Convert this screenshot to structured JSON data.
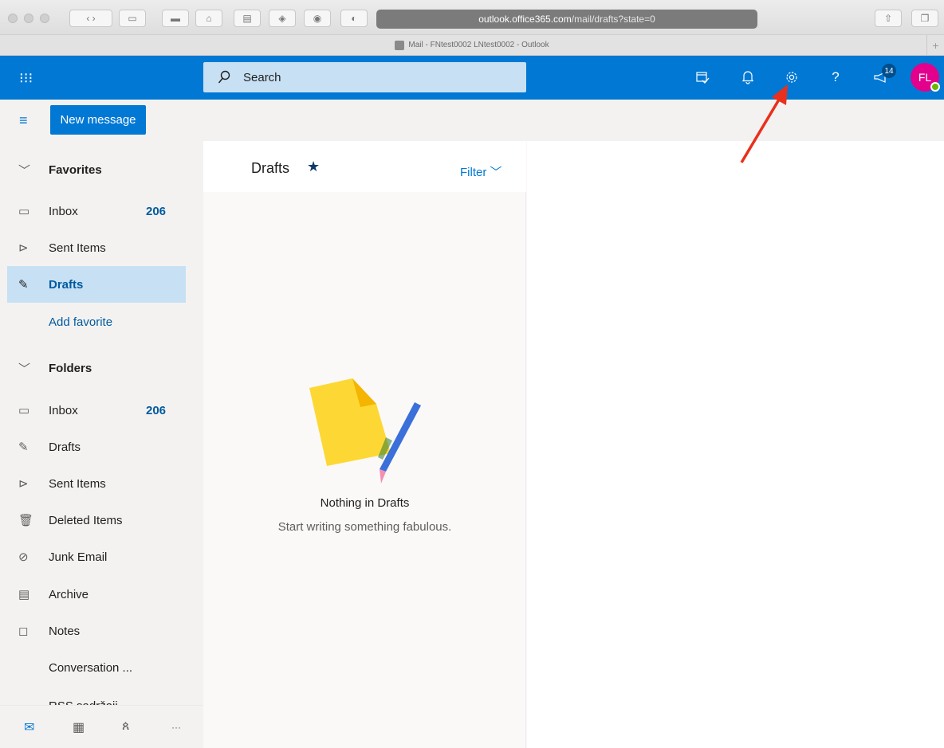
{
  "browser": {
    "url_domain": "outlook.office365.com",
    "url_path": "/mail/drafts?state=0",
    "tab_title": "Mail - FNtest0002 LNtest0002 - Outlook",
    "new_tab_symbol": "+"
  },
  "header": {
    "search_placeholder": "Search",
    "notification_count": "14",
    "avatar_initials": "FL",
    "icons": [
      "app-launcher-icon",
      "my-day-icon",
      "bell-icon",
      "gear-icon",
      "help-icon",
      "feedback-icon"
    ]
  },
  "commandbar": {
    "new_message_label": "New message"
  },
  "favorites": {
    "header": "Favorites",
    "items": [
      {
        "label": "Inbox",
        "count": "206",
        "icon": "inbox-icon"
      },
      {
        "label": "Sent Items",
        "count": "",
        "icon": "send-icon"
      },
      {
        "label": "Drafts",
        "count": "",
        "icon": "pencil-icon",
        "selected": true
      }
    ],
    "add_favorite_label": "Add favorite"
  },
  "folders": {
    "header": "Folders",
    "items": [
      {
        "label": "Inbox",
        "count": "206",
        "icon": "inbox-icon"
      },
      {
        "label": "Drafts",
        "count": "",
        "icon": "pencil-icon"
      },
      {
        "label": "Sent Items",
        "count": "",
        "icon": "send-icon"
      },
      {
        "label": "Deleted Items",
        "count": "",
        "icon": "trash-icon"
      },
      {
        "label": "Junk Email",
        "count": "",
        "icon": "block-icon"
      },
      {
        "label": "Archive",
        "count": "",
        "icon": "archive-icon"
      },
      {
        "label": "Notes",
        "count": "",
        "icon": "note-icon"
      },
      {
        "label": "Conversation ...",
        "count": "",
        "icon": ""
      },
      {
        "label": "RSS sadržaji",
        "count": "",
        "icon": ""
      }
    ]
  },
  "bottom_nav": {
    "icons": [
      "mail-icon",
      "calendar-icon",
      "people-icon",
      "more-icon"
    ],
    "more_label": "···"
  },
  "message_list": {
    "title": "Drafts",
    "filter_label": "Filter",
    "empty_title": "Nothing in Drafts",
    "empty_subtitle": "Start writing something fabulous."
  },
  "colors": {
    "brand_blue": "#0078d4",
    "selected_bg": "#c7e0f4",
    "annotation_arrow": "#e8301c"
  }
}
